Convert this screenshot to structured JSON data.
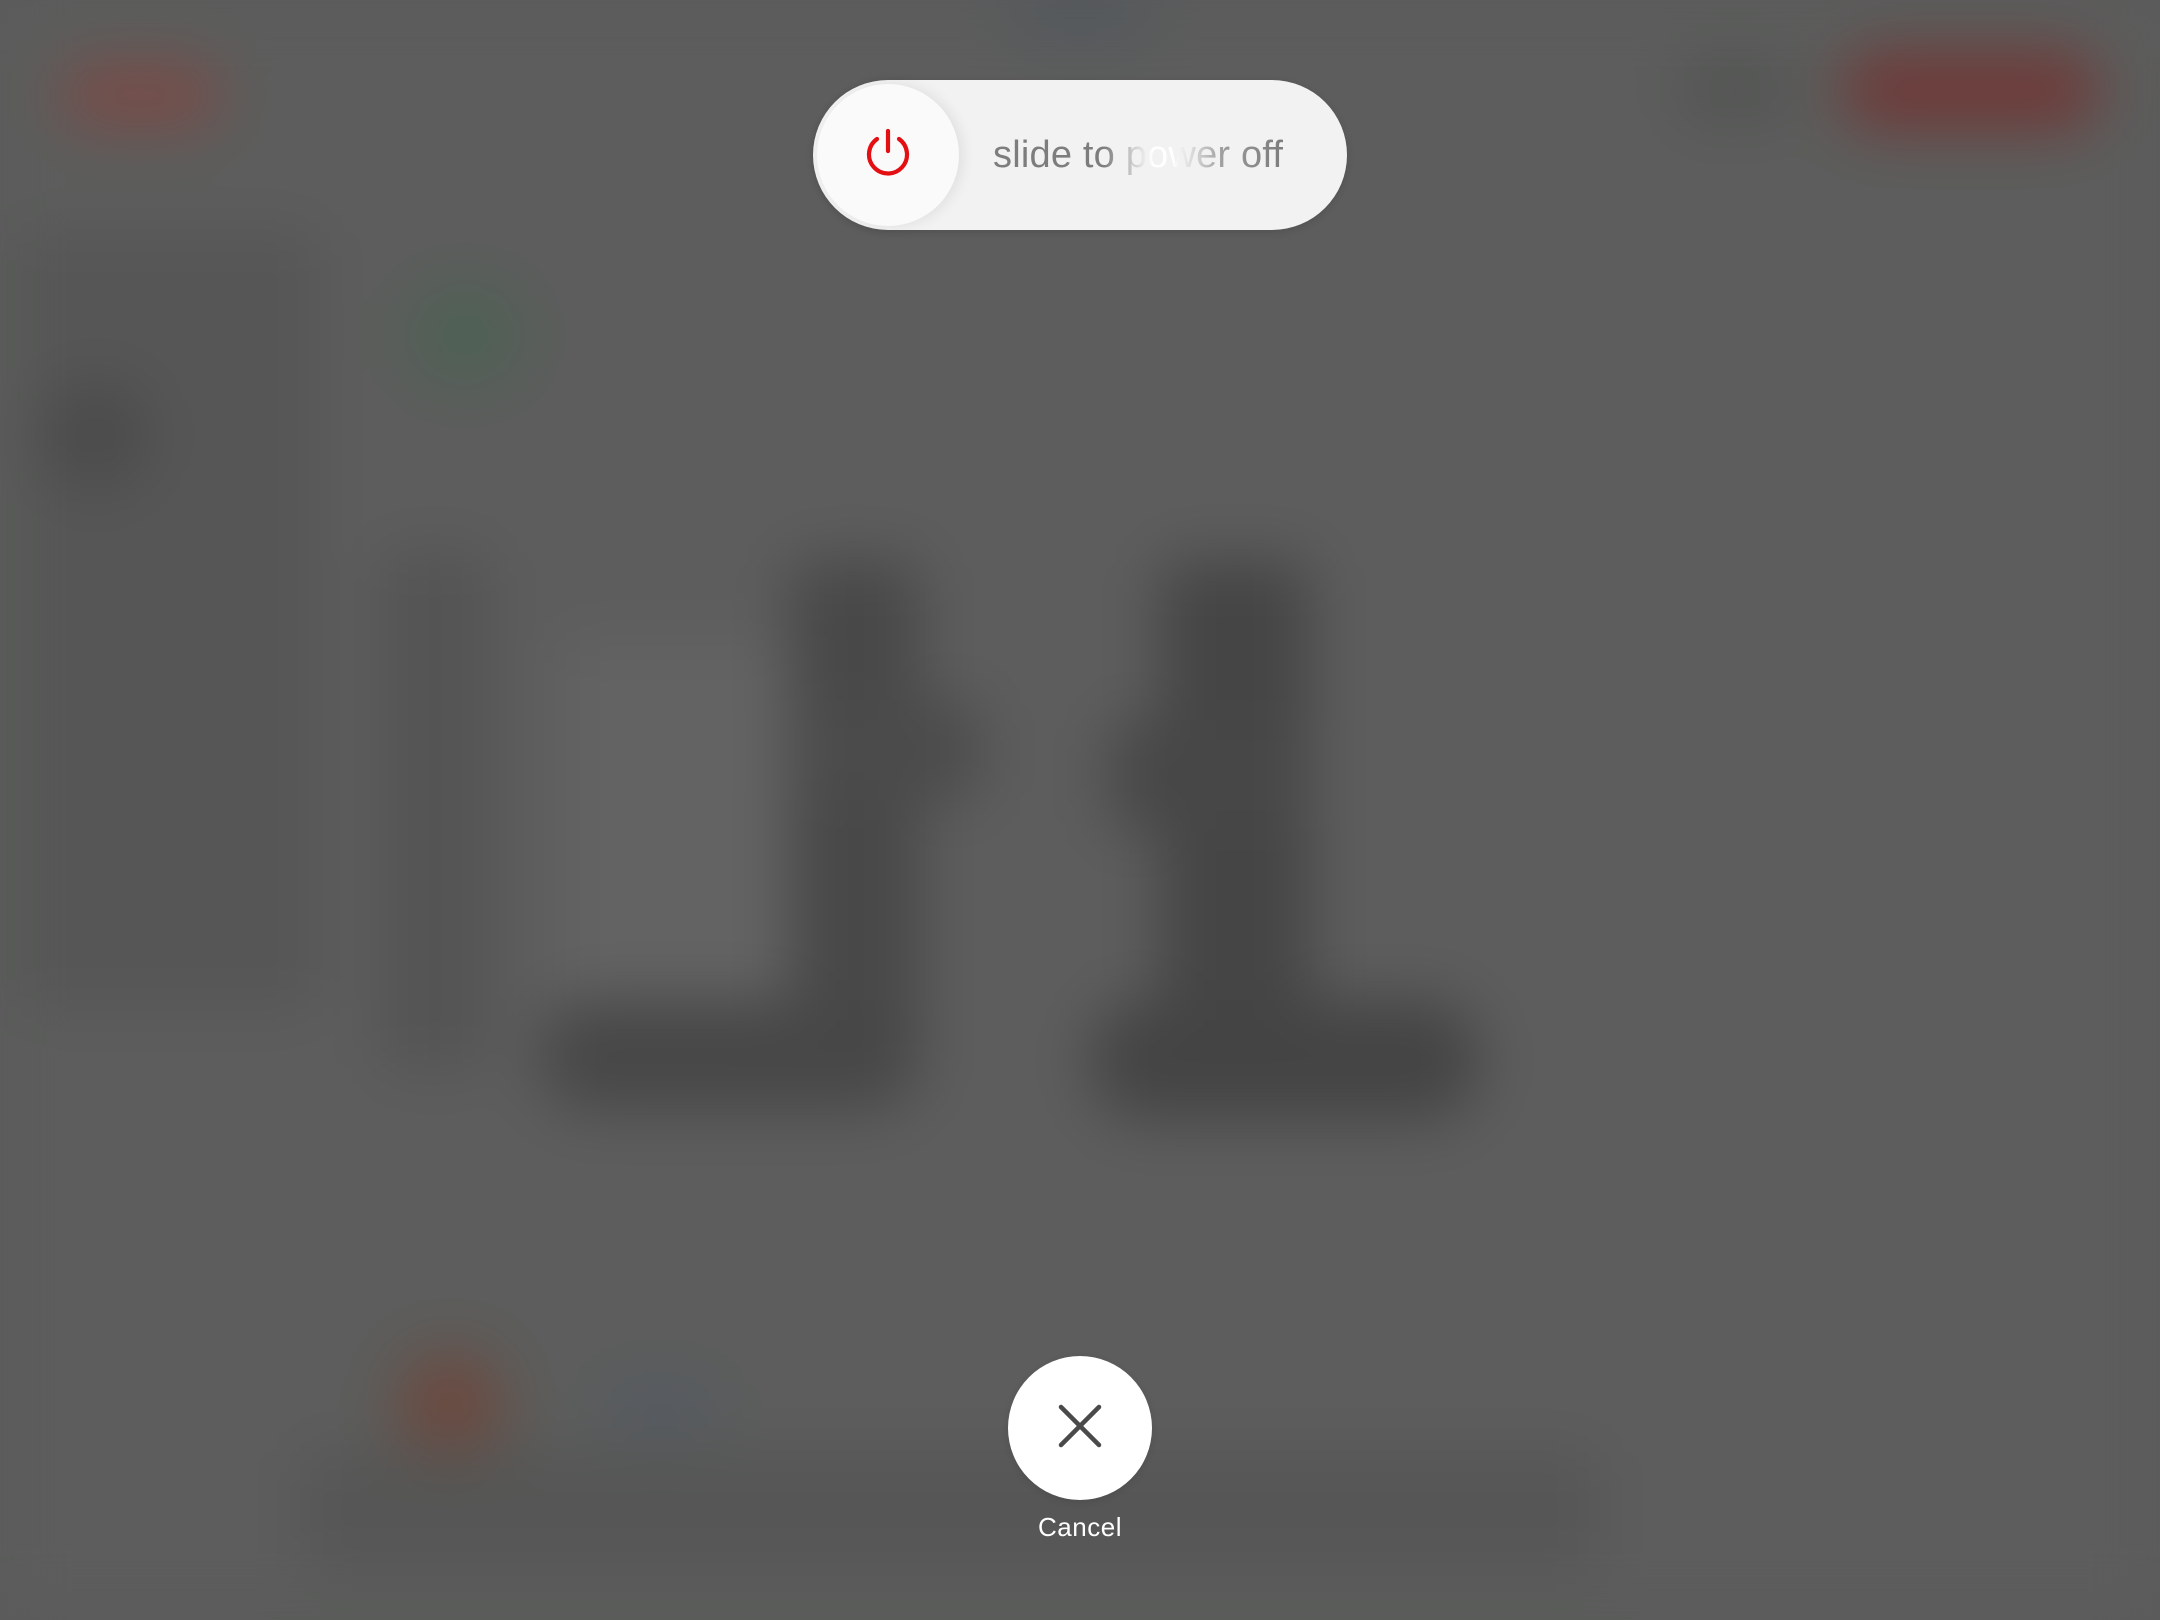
{
  "power_slider": {
    "label": "slide to power off",
    "icon": "power-icon",
    "icon_color": "#e30f12"
  },
  "cancel": {
    "icon": "close-icon",
    "label": "Cancel"
  },
  "colors": {
    "dim_background": "#5a5b5a",
    "slider_background": "#f2f2f2",
    "button_background": "#ffffff",
    "icon_dark": "#4a4a4a"
  }
}
